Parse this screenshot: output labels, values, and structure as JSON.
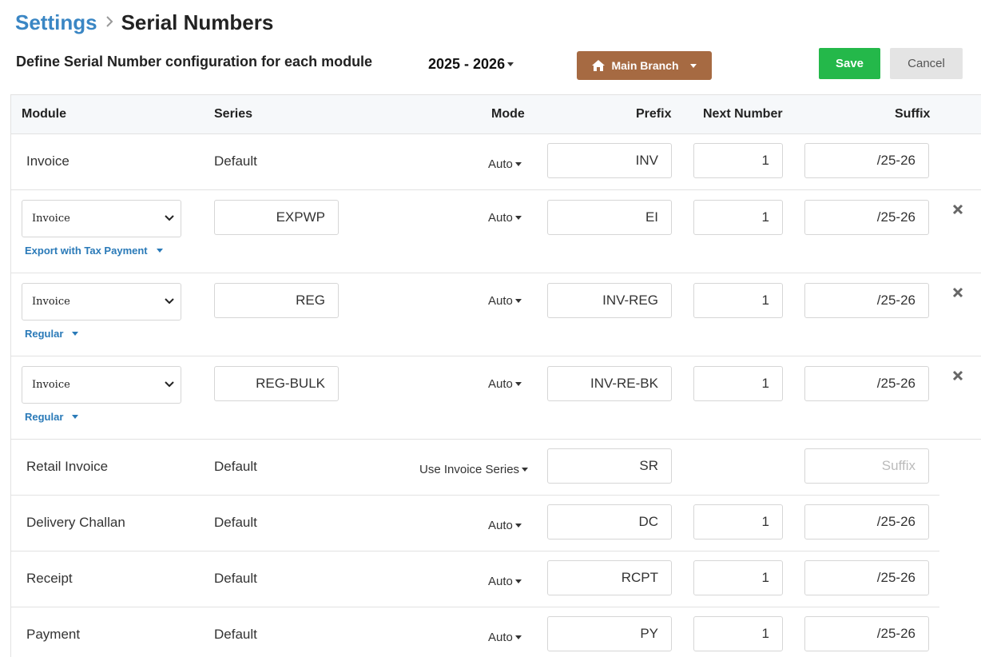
{
  "breadcrumb": {
    "parent": "Settings",
    "current": "Serial Numbers"
  },
  "subtitle": "Define Serial Number configuration for each module",
  "year": "2025 - 2026",
  "branch_label": "Main Branch",
  "actions": {
    "save": "Save",
    "cancel": "Cancel"
  },
  "columns": {
    "module": "Module",
    "series": "Series",
    "mode": "Mode",
    "prefix": "Prefix",
    "next_number": "Next Number",
    "suffix": "Suffix"
  },
  "rows": [
    {
      "module": "Invoice",
      "series": "Default",
      "mode": "Auto",
      "prefix": "INV",
      "next": "1",
      "suffix": "/25-26"
    },
    {
      "module": "Invoice",
      "subtype": "Export with Tax Payment",
      "series": "EXPWP",
      "mode": "Auto",
      "prefix": "EI",
      "next": "1",
      "suffix": "/25-26"
    },
    {
      "module": "Invoice",
      "subtype": "Regular",
      "series": "REG",
      "mode": "Auto",
      "prefix": "INV-REG",
      "next": "1",
      "suffix": "/25-26"
    },
    {
      "module": "Invoice",
      "subtype": "Regular",
      "series": "REG-BULK",
      "mode": "Auto",
      "prefix": "INV-RE-BK",
      "next": "1",
      "suffix": "/25-26"
    },
    {
      "module": "Retail Invoice",
      "series": "Default",
      "mode": "Use Invoice Series",
      "prefix": "SR",
      "suffix_placeholder": "Suffix"
    },
    {
      "module": "Delivery Challan",
      "series": "Default",
      "mode": "Auto",
      "prefix": "DC",
      "next": "1",
      "suffix": "/25-26"
    },
    {
      "module": "Receipt",
      "series": "Default",
      "mode": "Auto",
      "prefix": "RCPT",
      "next": "1",
      "suffix": "/25-26"
    },
    {
      "module": "Payment",
      "series": "Default",
      "mode": "Auto",
      "prefix": "PY",
      "next": "1",
      "suffix": "/25-26"
    }
  ],
  "icons": {
    "home": "home-icon",
    "remove": "close-icon",
    "dropdown": "caret-down-icon"
  },
  "colors": {
    "link": "#3a86c4",
    "branch": "#a66a42",
    "save": "#24b84a",
    "subtype": "#2a7ab8"
  }
}
